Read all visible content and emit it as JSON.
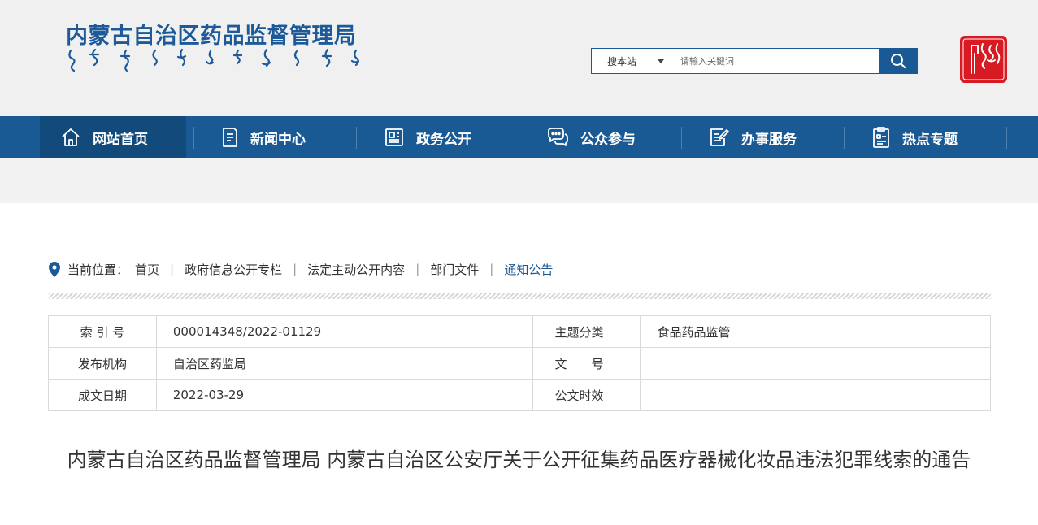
{
  "header": {
    "site_title": "内蒙古自治区药品监督管理局",
    "search": {
      "scope": "搜本站",
      "placeholder": "请输入关键词"
    },
    "colors": {
      "primary": "#1a5a94",
      "seal": "#d81a22"
    }
  },
  "nav": {
    "items": [
      {
        "label": "网站首页",
        "icon": "home-icon",
        "active": true
      },
      {
        "label": "新闻中心",
        "icon": "news-document-icon"
      },
      {
        "label": "政务公开",
        "icon": "newspaper-icon"
      },
      {
        "label": "公众参与",
        "icon": "chat-bubbles-icon"
      },
      {
        "label": "办事服务",
        "icon": "form-edit-icon"
      },
      {
        "label": "热点专题",
        "icon": "clipboard-icon"
      }
    ]
  },
  "breadcrumb": {
    "label": "当前位置：",
    "items": [
      "首页",
      "政府信息公开专栏",
      "法定主动公开内容",
      "部门文件",
      "通知公告"
    ]
  },
  "info_table": {
    "rows": [
      {
        "label1": "索 引 号",
        "value1": "000014348/2022-01129",
        "label2": "主题分类",
        "value2": "食品药品监管"
      },
      {
        "label1": "发布机构",
        "value1": "自治区药监局",
        "label2": "文　　号",
        "value2": ""
      },
      {
        "label1": "成文日期",
        "value1": "2022-03-29",
        "label2": "公文时效",
        "value2": ""
      }
    ]
  },
  "article": {
    "title": "内蒙古自治区药品监督管理局 内蒙古自治区公安厅关于公开征集药品医疗器械化妆品违法犯罪线索的通告"
  }
}
